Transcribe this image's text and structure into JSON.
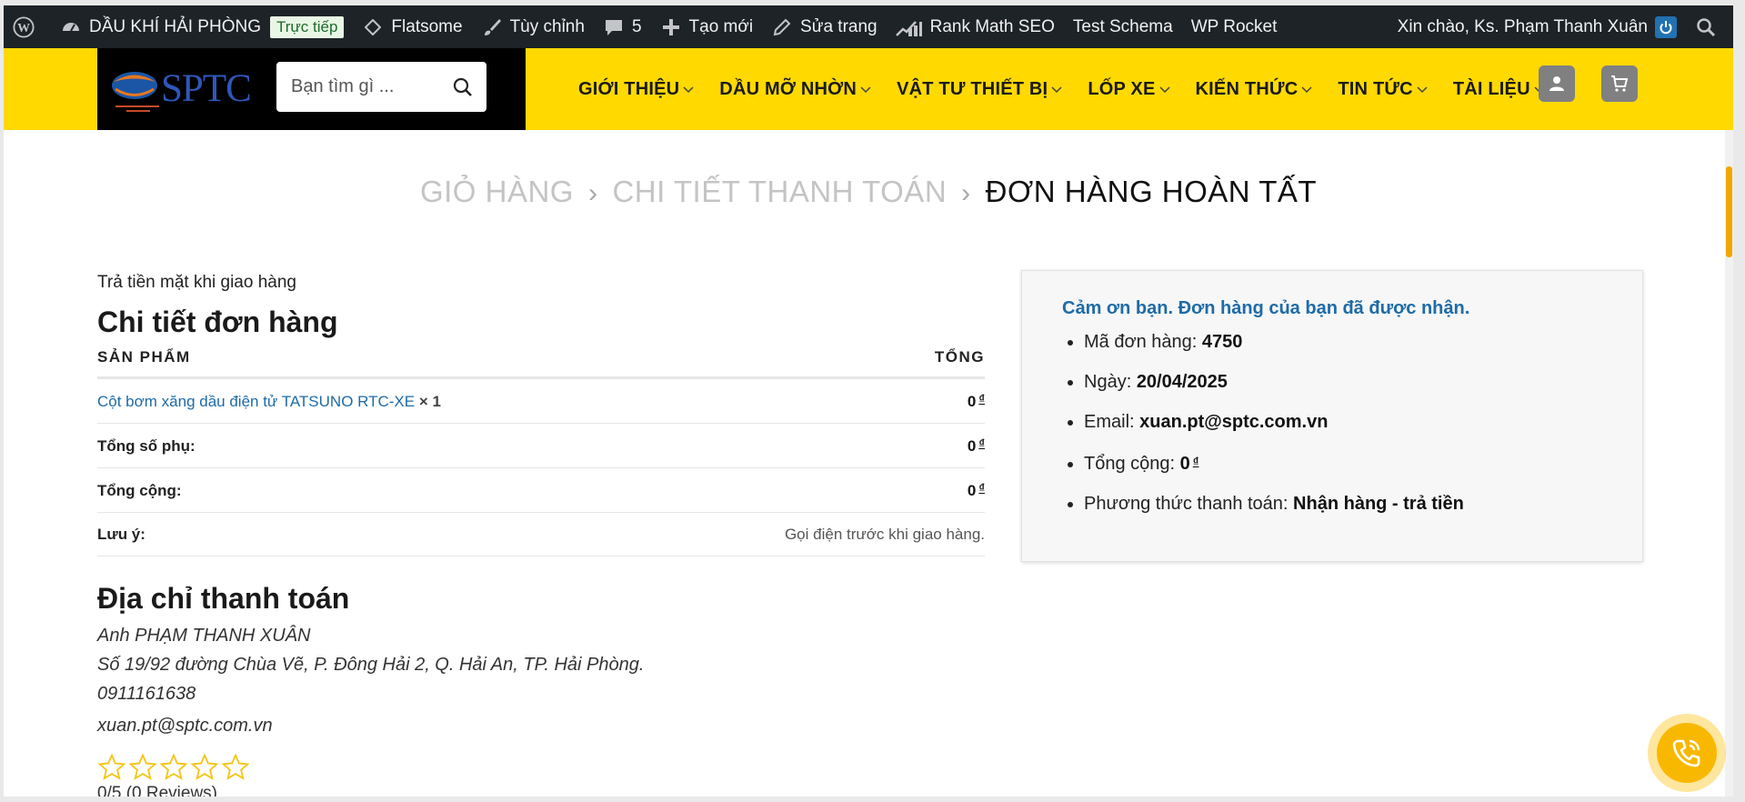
{
  "adminbar": {
    "site_name": "DẦU KHÍ HẢI PHÒNG",
    "live_badge": "Trực tiếp",
    "theme": "Flatsome",
    "customize": "Tùy chỉnh",
    "comments_count": "5",
    "new": "Tạo mới",
    "edit_page": "Sửa trang",
    "rank_math": "Rank Math SEO",
    "test_schema": "Test Schema",
    "wp_rocket": "WP Rocket",
    "greeting": "Xin chào, Ks. Phạm Thanh Xuân"
  },
  "header": {
    "logo_text": "SPTC",
    "search_placeholder": "Bạn tìm gì ...",
    "nav": [
      {
        "label": "GIỚI THIỆU"
      },
      {
        "label": "DẦU MỠ NHỜN"
      },
      {
        "label": "VẬT TƯ THIẾT BỊ"
      },
      {
        "label": "LỐP XE"
      },
      {
        "label": "KIẾN THỨC"
      },
      {
        "label": "TIN TỨC"
      },
      {
        "label": "TÀI LIỆU"
      }
    ]
  },
  "breadcrumb": {
    "step1": "GIỎ HÀNG",
    "step2": "CHI TIẾT THANH TOÁN",
    "step3": "ĐƠN HÀNG HOÀN TẤT",
    "separator": "›"
  },
  "order": {
    "payment_method_text": "Trả tiền mặt khi giao hàng",
    "title": "Chi tiết đơn hàng",
    "col_product": "SẢN PHẨM",
    "col_total": "TỔNG",
    "product_name": "Cột bơm xăng dầu điện tử TATSUNO RTC-XE",
    "product_qty": "× 1",
    "product_total": "0",
    "subtotal_label": "Tổng số phụ:",
    "subtotal_value": "0",
    "total_label": "Tổng cộng:",
    "total_value": "0",
    "note_label": "Lưu ý:",
    "note_value": "Gọi điện trước khi giao hàng.",
    "currency": "₫"
  },
  "billing": {
    "title": "Địa chỉ thanh toán",
    "name": "Anh PHẠM THANH XUÂN",
    "address": "Số 19/92 đường Chùa Vẽ, P. Đông Hải 2, Q. Hải An, TP. Hải Phòng.",
    "phone": "0911161638",
    "email": "xuan.pt@sptc.com.vn",
    "rating_value": 0,
    "rating_max": 5,
    "reviews_text": "0/5 (0 Reviews)"
  },
  "thankyou": {
    "message": "Cảm ơn bạn. Đơn hàng của bạn đã được nhận.",
    "order_number_label": "Mã đơn hàng:",
    "order_number": "4750",
    "date_label": "Ngày:",
    "date": "20/04/2025",
    "email_label": "Email:",
    "email": "xuan.pt@sptc.com.vn",
    "total_label": "Tổng cộng:",
    "total": "0",
    "currency": "₫",
    "payment_label": "Phương thức thanh toán:",
    "payment": "Nhận hàng - trả tiền"
  },
  "colors": {
    "header_bg": "#ffd900",
    "adminbar_bg": "#1d2327",
    "link": "#1e6ba8",
    "star": "#f5c518"
  }
}
